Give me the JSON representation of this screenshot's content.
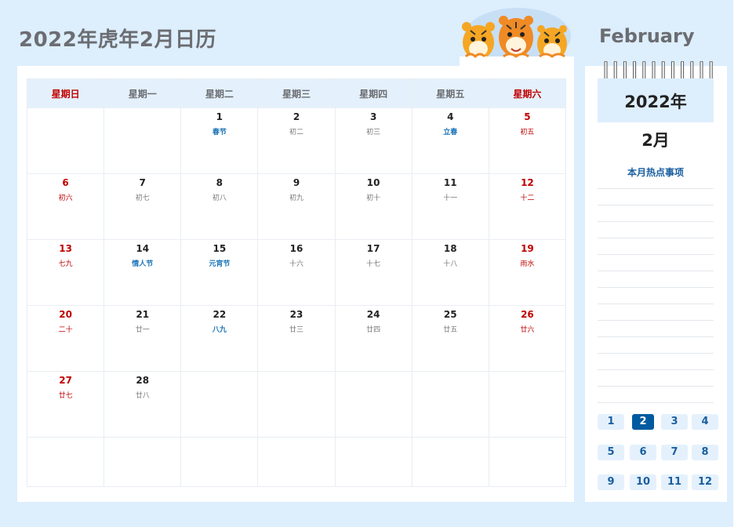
{
  "title": "2022年虎年2月日历",
  "month_en": "February",
  "weekdays": [
    "星期日",
    "星期一",
    "星期二",
    "星期三",
    "星期四",
    "星期五",
    "星期六"
  ],
  "weeks": [
    [
      {
        "day": "",
        "sub": ""
      },
      {
        "day": "",
        "sub": ""
      },
      {
        "day": "1",
        "sub": "春节"
      },
      {
        "day": "2",
        "sub": "初二"
      },
      {
        "day": "3",
        "sub": "初三"
      },
      {
        "day": "4",
        "sub": "立春"
      },
      {
        "day": "5",
        "sub": "初五"
      }
    ],
    [
      {
        "day": "6",
        "sub": "初六"
      },
      {
        "day": "7",
        "sub": "初七"
      },
      {
        "day": "8",
        "sub": "初八"
      },
      {
        "day": "9",
        "sub": "初九"
      },
      {
        "day": "10",
        "sub": "初十"
      },
      {
        "day": "11",
        "sub": "十一"
      },
      {
        "day": "12",
        "sub": "十二"
      }
    ],
    [
      {
        "day": "13",
        "sub": "七九"
      },
      {
        "day": "14",
        "sub": "情人节"
      },
      {
        "day": "15",
        "sub": "元宵节"
      },
      {
        "day": "16",
        "sub": "十六"
      },
      {
        "day": "17",
        "sub": "十七"
      },
      {
        "day": "18",
        "sub": "十八"
      },
      {
        "day": "19",
        "sub": "雨水"
      }
    ],
    [
      {
        "day": "20",
        "sub": "二十"
      },
      {
        "day": "21",
        "sub": "廿一"
      },
      {
        "day": "22",
        "sub": "八九"
      },
      {
        "day": "23",
        "sub": "廿三"
      },
      {
        "day": "24",
        "sub": "廿四"
      },
      {
        "day": "25",
        "sub": "廿五"
      },
      {
        "day": "26",
        "sub": "廿六"
      }
    ],
    [
      {
        "day": "27",
        "sub": "廿七"
      },
      {
        "day": "28",
        "sub": "廿八"
      },
      {
        "day": "",
        "sub": ""
      },
      {
        "day": "",
        "sub": ""
      },
      {
        "day": "",
        "sub": ""
      },
      {
        "day": "",
        "sub": ""
      },
      {
        "day": "",
        "sub": ""
      }
    ],
    [
      {
        "day": "",
        "sub": ""
      },
      {
        "day": "",
        "sub": ""
      },
      {
        "day": "",
        "sub": ""
      },
      {
        "day": "",
        "sub": ""
      },
      {
        "day": "",
        "sub": ""
      },
      {
        "day": "",
        "sub": ""
      },
      {
        "day": "",
        "sub": ""
      }
    ]
  ],
  "festivals": [
    "春节",
    "立春",
    "情人节",
    "元宵节",
    "八九"
  ],
  "side": {
    "year": "2022年",
    "month": "2月",
    "hot_label": "本月热点事项"
  },
  "months": [
    "1",
    "2",
    "3",
    "4",
    "5",
    "6",
    "7",
    "8",
    "9",
    "10",
    "11",
    "12"
  ],
  "active_month": "2",
  "colors": {
    "background": "#ddeefd",
    "weekend": "#c00000",
    "festival": "#1a73b8",
    "accent": "#005aa0",
    "title": "#6b6d72"
  },
  "decoration": "three-tigers-illustration"
}
